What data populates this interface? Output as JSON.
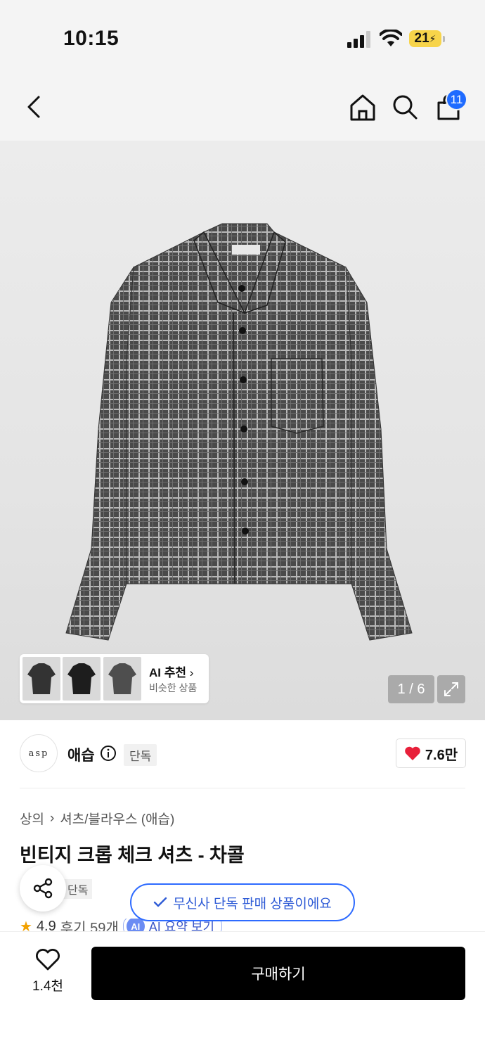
{
  "status_bar": {
    "time": "10:15",
    "battery": "21"
  },
  "nav": {
    "cart_count": "11"
  },
  "hero": {
    "ai_rec_title": "AI 추천",
    "ai_rec_sub": "비슷한 상품",
    "pager": "1 / 6"
  },
  "brand": {
    "logo_text": "asp",
    "name": "애습",
    "tag": "단독",
    "likes": "7.6만",
    "heart_color": "#e8203a"
  },
  "breadcrumb": {
    "level1": "상의",
    "level2": "셔츠/블라우스 (애습)"
  },
  "product": {
    "title": "빈티지 크롭 체크 셔츠 - 차콜",
    "tag": "단독",
    "rating": "4.9",
    "reviews": "후기 59개",
    "ai_chip_badge": "AI",
    "ai_chip": "AI 요약 보기"
  },
  "toast": {
    "text": "무신사 단독 판매 상품이에요"
  },
  "bottom": {
    "wish_count": "1.4천",
    "buy_label": "구매하기"
  }
}
